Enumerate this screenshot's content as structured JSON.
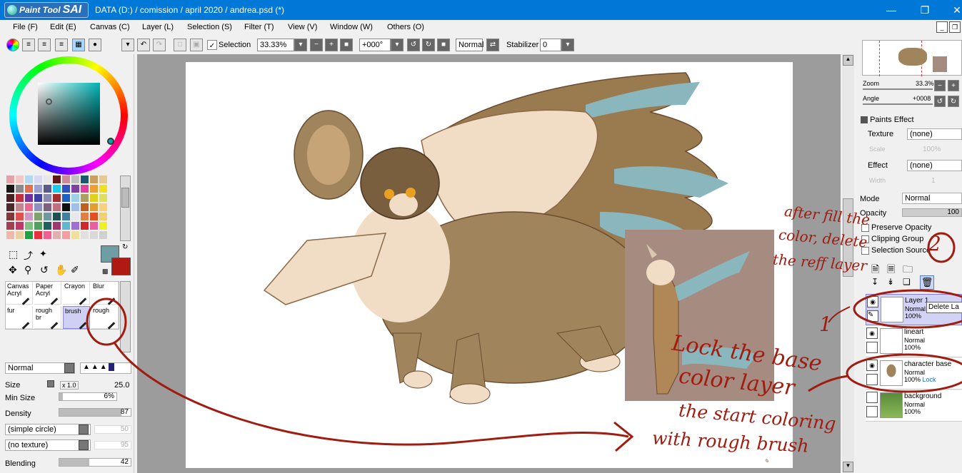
{
  "app": {
    "logo_small": "Paint Tool",
    "logo_big": "SAI",
    "title": "DATA (D:) / comission / april 2020 / andrea.psd (*)"
  },
  "menu": [
    "File (F)",
    "Edit (E)",
    "Canvas (C)",
    "Layer (L)",
    "Selection (S)",
    "Filter (T)",
    "View (V)",
    "Window (W)",
    "Others (O)"
  ],
  "toolbar": {
    "selection_label": "Selection",
    "zoom_value": "33.33%",
    "rotation_value": "+000°",
    "blend_value": "Normal",
    "stabilizer_label": "Stabilizer",
    "stabilizer_value": "0"
  },
  "colors": {
    "main_color": "#b01a12",
    "sub_color": "#6e9ea3",
    "accent": "#0078d7",
    "annotation": "#a01c10"
  },
  "palette": [
    "#e8a0a8",
    "#f0c8c8",
    "#b0d8f0",
    "#d8d8f0",
    "#e8e8e8",
    "#5a1818",
    "#d08898",
    "#c0c0c0",
    "#1a5a6a",
    "#c8a060",
    "#e8c890",
    "#181818",
    "#8a8a8a",
    "#e07050",
    "#a0a0d0",
    "#5a5a8a",
    "#20c8e8",
    "#3050c0",
    "#8040a0",
    "#e040a0",
    "#f0a030",
    "#f0e020",
    "#482020",
    "#c03040",
    "#7030a0",
    "#4040a0",
    "#8a8ab0",
    "#a03030",
    "#2060c0",
    "#a0d0e8",
    "#b0a060",
    "#e0d020",
    "#e0e060",
    "#502828",
    "#c08890",
    "#e86890",
    "#9090c0",
    "#806080",
    "#c07080",
    "#101010",
    "#a0c0e8",
    "#c06020",
    "#e0a030",
    "#f8d080",
    "#803838",
    "#e05050",
    "#d098c0",
    "#80a070",
    "#7098a0",
    "#205050",
    "#4080a0",
    "#e8e8e8",
    "#e08040",
    "#e05020",
    "#f0d070",
    "#a04050",
    "#c03868",
    "#80c080",
    "#50a060",
    "#206060",
    "#a03870",
    "#60b8d0",
    "#a070d0",
    "#d02828",
    "#e860a0",
    "#f0f020",
    "#f0b8a8",
    "#e8d0a0",
    "#20a040",
    "#e83040",
    "#f06090",
    "#e0b0b0",
    "#f0a0a0",
    "#f0e0a0",
    "#e0e0e0",
    "#d8d8d8",
    "#d0d0d0"
  ],
  "brushes": [
    {
      "name": "Canvas Acryl"
    },
    {
      "name": "Paper Acryl"
    },
    {
      "name": "Crayon"
    },
    {
      "name": "Blur"
    },
    {
      "name": "fur"
    },
    {
      "name": "rough br"
    },
    {
      "name": "brush"
    },
    {
      "name": "rough"
    }
  ],
  "brush_settings": {
    "blend_mode": "Normal",
    "size_label": "Size",
    "size_multiplier": "x 1.0",
    "size_value": "25.0",
    "min_size_label": "Min Size",
    "min_size_value": "6%",
    "density_label": "Density",
    "density_value": "87",
    "shape_value": "(simple circle)",
    "shape_strength": "50",
    "texture_value": "(no texture)",
    "texture_strength": "95",
    "blending_label": "Blending",
    "blending_value": "42"
  },
  "navigator": {
    "zoom_label": "Zoom",
    "zoom_value": "33.3%",
    "angle_label": "Angle",
    "angle_value": "+0008"
  },
  "paints_effect": {
    "header": "Paints Effect",
    "texture_label": "Texture",
    "texture_value": "(none)",
    "scale_label": "Scale",
    "scale_value": "100%",
    "effect_label": "Effect",
    "effect_value": "(none)",
    "width_label": "Width",
    "width_value": "1"
  },
  "layer_panel": {
    "mode_label": "Mode",
    "mode_value": "Normal",
    "opacity_label": "Opacity",
    "opacity_value": "100",
    "preserve_opacity": "Preserve Opacity",
    "clipping_group": "Clipping Group",
    "selection_source": "Selection Source",
    "tooltip": "Delete La"
  },
  "layers": [
    {
      "name": "Layer 1",
      "mode": "Normal",
      "opacity": "100%",
      "lock": ""
    },
    {
      "name": "lineart",
      "mode": "Normal",
      "opacity": "100%",
      "lock": ""
    },
    {
      "name": "character base",
      "mode": "Normal",
      "opacity": "100%",
      "lock": "Lock"
    },
    {
      "name": "background",
      "mode": "Normal",
      "opacity": "100%",
      "lock": ""
    }
  ],
  "annotations": {
    "note1_line1": "after fill the",
    "note1_line2": "color, delete",
    "note1_line3": "the reff layer",
    "note2_line1": "Lock the base",
    "note2_line2": "color layer",
    "note3_line1": "the start coloring",
    "note3_line2": "with rough brush",
    "num1": "1",
    "num2": "2"
  }
}
